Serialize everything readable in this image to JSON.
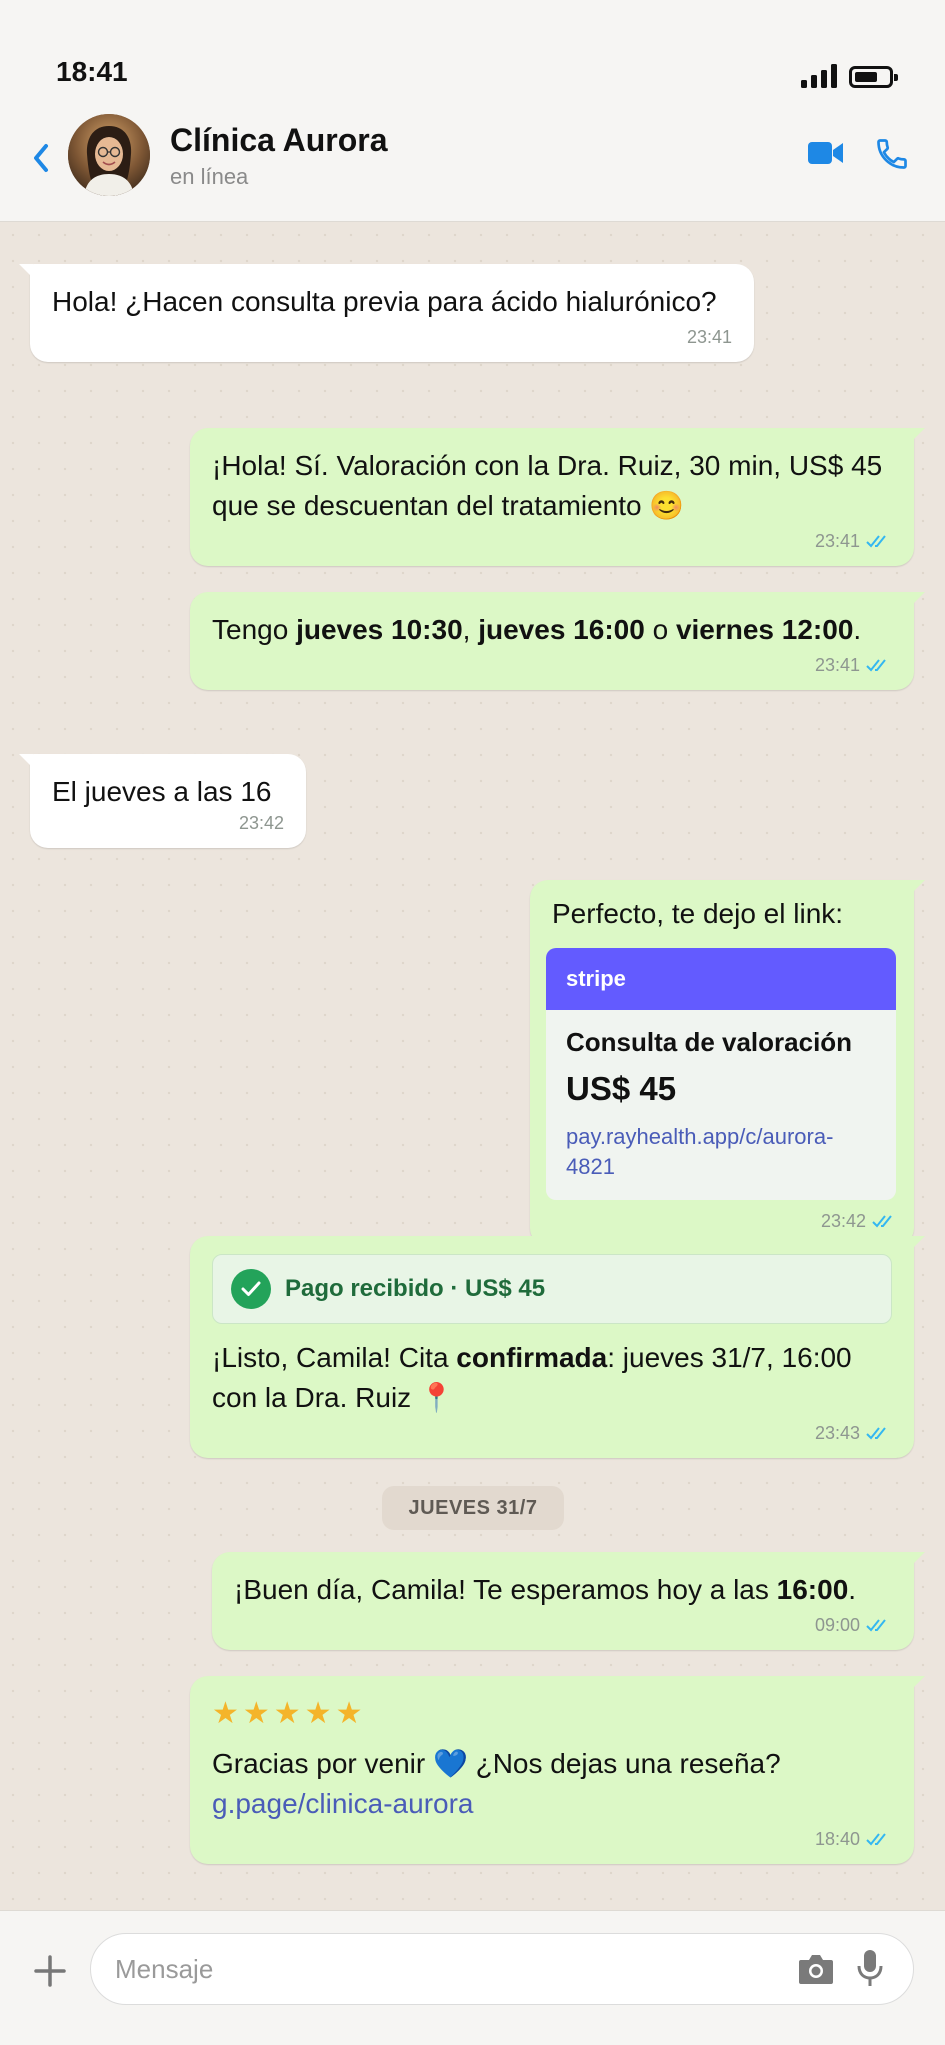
{
  "status_bar": {
    "time": "18:41"
  },
  "header": {
    "contact_name": "Clínica Aurora",
    "contact_status": "en línea"
  },
  "messages": [
    {
      "direction": "in",
      "text": "Hola! ¿Hacen consulta previa para ácido hialurónico?",
      "time": "23:41"
    },
    {
      "direction": "out",
      "text": "¡Hola! Sí. Valoración con la Dra. Ruiz, 30 min, US$ 45 que se descuentan del tratamiento 😊",
      "time": "23:41",
      "read": true
    },
    {
      "direction": "out",
      "parts": [
        "Tengo ",
        "jueves 10:30",
        ", ",
        "jueves 16:00",
        " o ",
        "viernes 12:00",
        "."
      ],
      "time": "23:41",
      "read": true
    },
    {
      "direction": "in",
      "text": "El jueves a las 16",
      "time": "23:42"
    },
    {
      "direction": "out",
      "text": "Perfecto, te dejo el link:",
      "time": "23:42",
      "read": true,
      "payment_card": {
        "brand": "stripe",
        "title": "Consulta de valoración",
        "amount": "US$ 45",
        "link": "pay.rayhealth.app/c/aurora-4821"
      }
    },
    {
      "direction": "out",
      "time": "23:43",
      "read": true,
      "banner": "Pago recibido · US$ 45",
      "parts": [
        "¡Listo, Camila! Cita ",
        "confirmada",
        ": jueves 31/7, 16:00 con la Dra. Ruiz 📍"
      ]
    },
    {
      "direction": "out",
      "parts": [
        "¡Buen día, Camila! Te esperamos hoy a las ",
        "16:00",
        "."
      ],
      "time": "09:00",
      "read": true
    },
    {
      "direction": "out",
      "time": "18:40",
      "read": true,
      "rating": 5,
      "stars": "★★★★★",
      "text": "Gracias por venir 💙 ¿Nos dejas una reseña?",
      "link": "g.page/clinica-aurora"
    }
  ],
  "date_separator": "JUEVES 31/7",
  "composer": {
    "placeholder": "Mensaje",
    "value": ""
  },
  "colors": {
    "accent": "#1e88e5",
    "outgoing_bubble": "#dcf8c6",
    "incoming_bubble": "#ffffff",
    "read_ticks": "#34b7f1",
    "stripe": "#635bff",
    "payment_ok": "#23a35a",
    "stars": "#f4b42a"
  },
  "icons": {
    "back": "chevron-left-icon",
    "video": "video-camera-icon",
    "call": "phone-icon",
    "attach": "plus-icon",
    "camera": "camera-icon",
    "mic": "microphone-icon",
    "read": "double-check-icon",
    "paid": "check-circle-icon",
    "location": "pin-emoji"
  }
}
